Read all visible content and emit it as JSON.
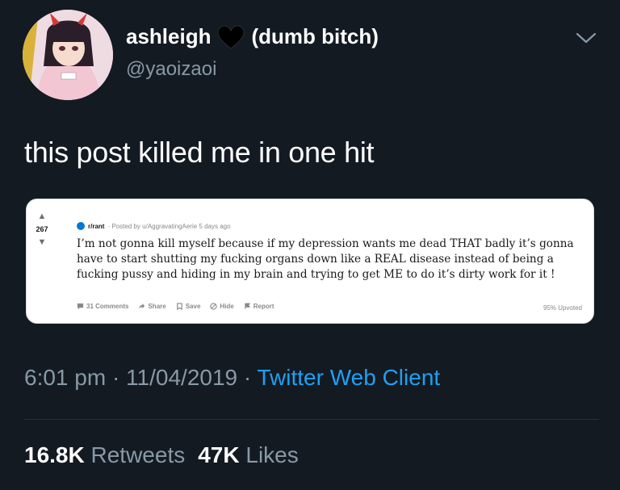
{
  "header": {
    "display_name": "ashleigh",
    "name_suffix": "(dumb bitch)",
    "handle": "@yaoizaoi",
    "heart_icon": "black-heart-icon",
    "menu_icon": "chevron-down-icon"
  },
  "tweet": {
    "text": "this post killed me in one hit"
  },
  "reddit_card": {
    "score": "267",
    "subreddit": "r/rant",
    "posted_by": "· Posted by u/AggravatingAerie 5 days ago",
    "body": "I’m not gonna kill myself because if my depression wants me dead THAT badly it’s gonna have to start shutting my fucking organs down like a REAL disease instead of being a fucking pussy and hiding in my brain and trying to get ME to do it’s dirty work for it !",
    "actions": {
      "comments": "31 Comments",
      "share": "Share",
      "save": "Save",
      "hide": "Hide",
      "report": "Report"
    },
    "upvoted": "95% Upvoted"
  },
  "meta": {
    "time": "6:01 pm · 11/04/2019 · ",
    "client": "Twitter Web Client"
  },
  "stats": {
    "retweets_count": "16.8K",
    "retweets_label": "Retweets",
    "likes_count": "47K",
    "likes_label": "Likes"
  },
  "colors": {
    "background": "#141a22",
    "link": "#1da1f2",
    "secondary_text": "#8899a6"
  }
}
